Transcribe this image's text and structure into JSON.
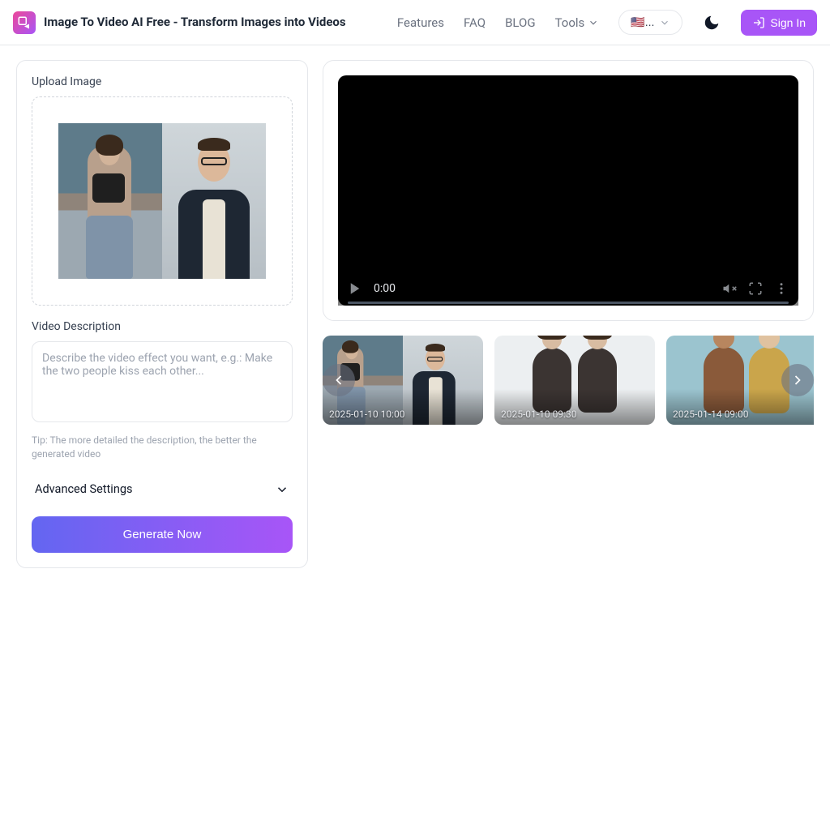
{
  "header": {
    "title": "Image To Video AI Free - Transform Images into Videos",
    "nav": {
      "features": "Features",
      "faq": "FAQ",
      "blog": "BLOG",
      "tools": "Tools"
    },
    "lang_label": "🇺🇸...",
    "signin": "Sign In"
  },
  "left": {
    "upload_label": "Upload Image",
    "desc_label": "Video Description",
    "desc_placeholder": "Describe the video effect you want, e.g.: Make the two people kiss each other...",
    "tip": "Tip: The more detailed the description, the better the generated video",
    "advanced": "Advanced Settings",
    "generate": "Generate Now"
  },
  "video": {
    "time": "0:00"
  },
  "thumbs": [
    {
      "ts": "2025-01-10 10:00"
    },
    {
      "ts": "2025-01-10 09:30"
    },
    {
      "ts": "2025-01-14 09:00"
    }
  ]
}
